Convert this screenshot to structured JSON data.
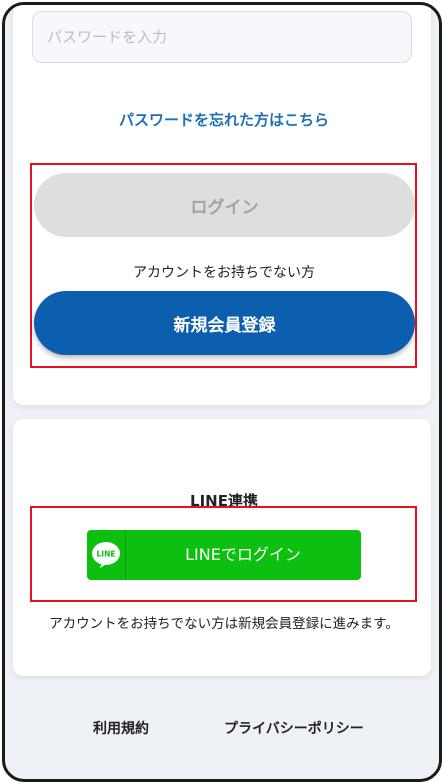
{
  "login_form": {
    "password_placeholder": "パスワードを入力",
    "forgot_password_link": "パスワードを忘れた方はこちら",
    "login_button": "ログイン",
    "no_account_text": "アカウントをお持ちでない方",
    "register_button": "新規会員登録"
  },
  "line_section": {
    "heading": "LINE連携",
    "logo_text": "LINE",
    "button_label": "LINEでログイン",
    "note": "アカウントをお持ちでない方は新規会員登録に進みます。"
  },
  "footer": {
    "terms_link": "利用規約",
    "privacy_link": "プライバシーポリシー"
  },
  "colors": {
    "brand_blue": "#0c5fae",
    "link_blue": "#1e6fb8",
    "line_green": "#0dbf0e",
    "highlight_red": "#e0141e",
    "disabled_gray": "#dedede"
  }
}
